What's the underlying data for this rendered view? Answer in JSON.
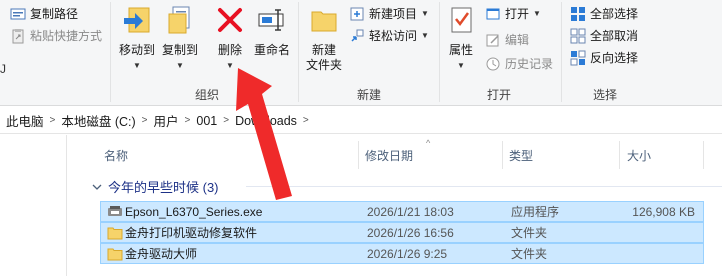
{
  "ribbon": {
    "clipboard_partial": {
      "copy_path": "复制路径",
      "paste_shortcut": "粘贴快捷方式"
    },
    "organize": {
      "move_to": "移动到",
      "copy_to": "复制到",
      "delete": "删除",
      "rename": "重命名",
      "label": "组织"
    },
    "new": {
      "new_folder_line1": "新建",
      "new_folder_line2": "文件夹",
      "new_item": "新建项目",
      "easy_access": "轻松访问",
      "label": "新建"
    },
    "open": {
      "properties": "属性",
      "open": "打开",
      "edit": "编辑",
      "history": "历史记录",
      "label": "打开"
    },
    "select": {
      "select_all": "全部选择",
      "select_none": "全部取消",
      "invert": "反向选择",
      "label": "选择"
    }
  },
  "address": {
    "crumbs": [
      "此电脑",
      "本地磁盘 (C:)",
      "用户",
      "001",
      "Downloads"
    ]
  },
  "columns": {
    "name": "名称",
    "date": "修改日期",
    "type": "类型",
    "size": "大小"
  },
  "group": {
    "title": "今年的早些时候 (3)"
  },
  "files": [
    {
      "name": "Epson_L6370_Series.exe",
      "date": "2026/1/21 18:03",
      "type": "应用程序",
      "size": "126,908 KB",
      "icon": "installer-icon"
    },
    {
      "name": "金舟打印机驱动修复软件",
      "date": "2026/1/26 16:56",
      "type": "文件夹",
      "size": "",
      "icon": "folder-icon"
    },
    {
      "name": "金舟驱动大师",
      "date": "2026/1/26 9:25",
      "type": "文件夹",
      "size": "",
      "icon": "folder-icon"
    }
  ],
  "colors": {
    "selection_bg": "#cce8ff",
    "selection_border": "#99d1ff",
    "delete_red": "#e81123",
    "annotation_arrow": "#ef2a2a",
    "folder_yellow": "#f6d36a"
  }
}
